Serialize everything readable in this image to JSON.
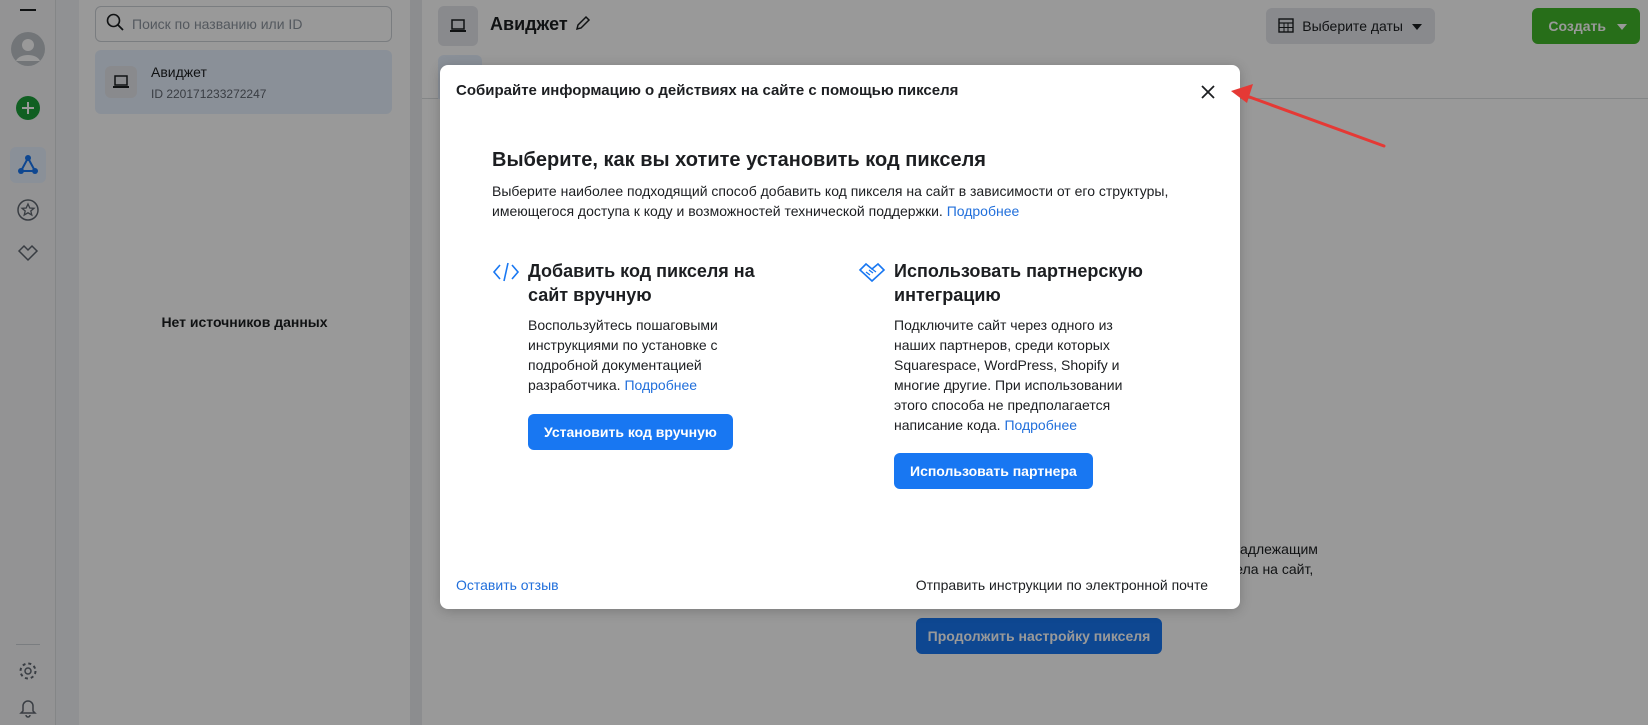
{
  "search": {
    "placeholder": "Поиск по названию или ID"
  },
  "source": {
    "name": "Авиджет",
    "id": "ID 220171233272247"
  },
  "list": {
    "empty_text": "Нет источников данных"
  },
  "header": {
    "title": "Авиджет",
    "date_label": "Выберите даты",
    "create_label": "Создать"
  },
  "background": {
    "partial_text_1": "т надлежащим",
    "partial_text_2": "ксела на сайт,",
    "continue_label": "Продолжить настройку пикселя"
  },
  "modal": {
    "title": "Собирайте информацию о действиях на сайте с помощью пикселя",
    "heading": "Выберите, как вы хотите установить код пикселя",
    "description": "Выберите наиболее подходящий способ добавить код пикселя на сайт в зависимости от его структуры, имеющегося доступа к коду и возможностей технической поддержки.",
    "more_link": "Подробнее",
    "option_manual": {
      "title": "Добавить код пикселя на сайт вручную",
      "text": "Воспользуйтесь пошаговыми инструкциями по установке с подробной документацией разработчика.",
      "more_link": "Подробнее",
      "button": "Установить код вручную"
    },
    "option_partner": {
      "title": "Использовать партнерскую интеграцию",
      "text": "Подключите сайт через одного из наших партнеров, среди которых Squarespace, WordPress, Shopify и многие другие. При использовании этого способа не предполагается написание кода.",
      "more_link": "Подробнее",
      "button": "Использовать партнера"
    },
    "feedback_link": "Оставить отзыв",
    "email_link": "Отправить инструкции по электронной почте"
  },
  "colors": {
    "brand_blue": "#1877f2",
    "link_blue": "#216fdb",
    "create_green": "#42b72a",
    "annotation_red": "#e53935"
  },
  "icons": [
    "menu-icon",
    "avatar",
    "add-icon",
    "events-manager-icon",
    "star-icon",
    "partner-icon",
    "gear-icon",
    "bell-icon",
    "search-icon",
    "laptop-icon",
    "pencil-icon",
    "calendar-icon",
    "caret-down-icon",
    "close-icon",
    "code-icon",
    "handshake-icon"
  ]
}
